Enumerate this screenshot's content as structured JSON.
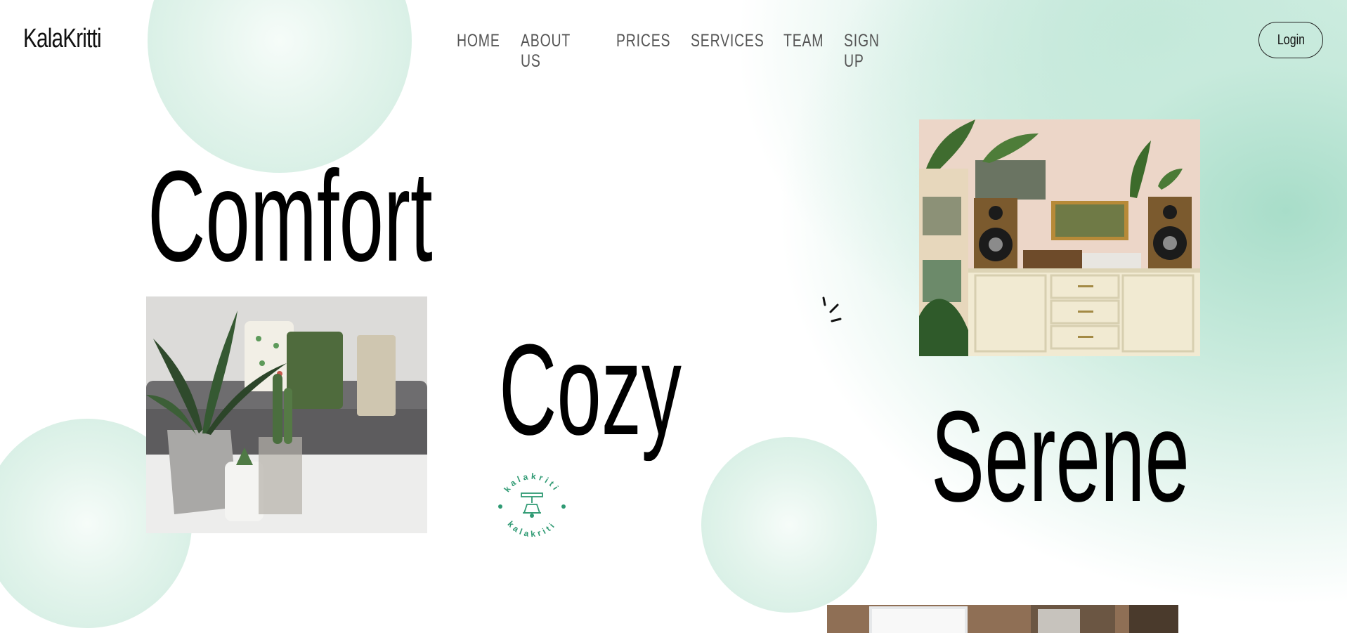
{
  "brand": {
    "name": "KalaKritti"
  },
  "nav": {
    "items": [
      "HOME",
      "ABOUT US",
      "PRICES",
      "SERVICES",
      "TEAM",
      "SIGN UP"
    ]
  },
  "header": {
    "login_label": "Login"
  },
  "hero": {
    "words": {
      "comfort": "Comfort",
      "cozy": "Cozy",
      "serene": "Serene"
    },
    "stamp_text": "kalakriti"
  },
  "colors": {
    "accent_mint": "#a8ddc9",
    "stamp_green": "#2f9a73",
    "text": "#000000",
    "nav_text": "#555555"
  },
  "icons": {
    "stamp": "lamp-logo-icon",
    "sparkle": "sparkle-icon"
  }
}
